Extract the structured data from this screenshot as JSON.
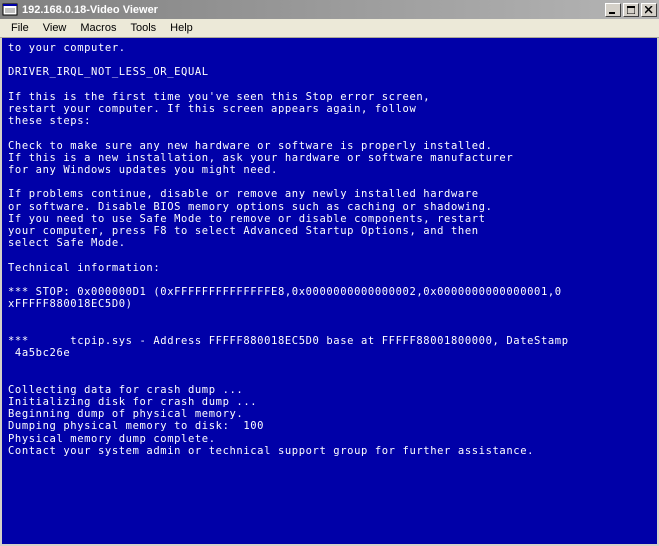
{
  "window": {
    "title": "192.168.0.18-Video Viewer"
  },
  "menu": {
    "file": "File",
    "view": "View",
    "macros": "Macros",
    "tools": "Tools",
    "help": "Help"
  },
  "bsod": {
    "line_top": "to your computer.",
    "error_code": "DRIVER_IRQL_NOT_LESS_OR_EQUAL",
    "instr1": "If this is the first time you've seen this Stop error screen,",
    "instr2": "restart your computer. If this screen appears again, follow",
    "instr3": "these steps:",
    "check1": "Check to make sure any new hardware or software is properly installed.",
    "check2": "If this is a new installation, ask your hardware or software manufacturer",
    "check3": "for any Windows updates you might need.",
    "prob1": "If problems continue, disable or remove any newly installed hardware",
    "prob2": "or software. Disable BIOS memory options such as caching or shadowing.",
    "prob3": "If you need to use Safe Mode to remove or disable components, restart",
    "prob4": "your computer, press F8 to select Advanced Startup Options, and then",
    "prob5": "select Safe Mode.",
    "tech_label": "Technical information:",
    "stop1": "*** STOP: 0x000000D1 (0xFFFFFFFFFFFFFFE8,0x0000000000000002,0x0000000000000001,0",
    "stop2": "xFFFFF880018EC5D0)",
    "module1": "***      tcpip.sys - Address FFFFF880018EC5D0 base at FFFFF88001800000, DateStamp",
    "module2": " 4a5bc26e",
    "dump1": "Collecting data for crash dump ...",
    "dump2": "Initializing disk for crash dump ...",
    "dump3": "Beginning dump of physical memory.",
    "dump4": "Dumping physical memory to disk:  100",
    "dump5": "Physical memory dump complete.",
    "dump6": "Contact your system admin or technical support group for further assistance."
  }
}
